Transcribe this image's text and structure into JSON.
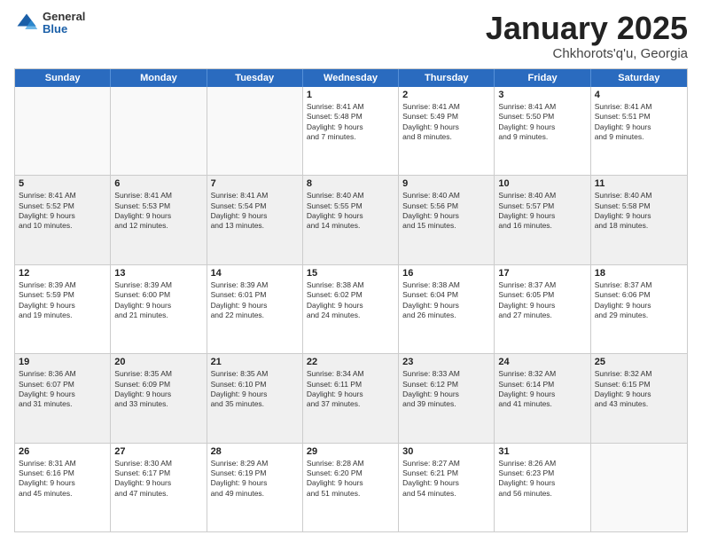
{
  "logo": {
    "general": "General",
    "blue": "Blue"
  },
  "header": {
    "title": "January 2025",
    "subtitle": "Chkhorots'q'u, Georgia"
  },
  "weekdays": [
    "Sunday",
    "Monday",
    "Tuesday",
    "Wednesday",
    "Thursday",
    "Friday",
    "Saturday"
  ],
  "weeks": [
    [
      {
        "day": "",
        "lines": []
      },
      {
        "day": "",
        "lines": []
      },
      {
        "day": "",
        "lines": []
      },
      {
        "day": "1",
        "lines": [
          "Sunrise: 8:41 AM",
          "Sunset: 5:48 PM",
          "Daylight: 9 hours",
          "and 7 minutes."
        ]
      },
      {
        "day": "2",
        "lines": [
          "Sunrise: 8:41 AM",
          "Sunset: 5:49 PM",
          "Daylight: 9 hours",
          "and 8 minutes."
        ]
      },
      {
        "day": "3",
        "lines": [
          "Sunrise: 8:41 AM",
          "Sunset: 5:50 PM",
          "Daylight: 9 hours",
          "and 9 minutes."
        ]
      },
      {
        "day": "4",
        "lines": [
          "Sunrise: 8:41 AM",
          "Sunset: 5:51 PM",
          "Daylight: 9 hours",
          "and 9 minutes."
        ]
      }
    ],
    [
      {
        "day": "5",
        "lines": [
          "Sunrise: 8:41 AM",
          "Sunset: 5:52 PM",
          "Daylight: 9 hours",
          "and 10 minutes."
        ]
      },
      {
        "day": "6",
        "lines": [
          "Sunrise: 8:41 AM",
          "Sunset: 5:53 PM",
          "Daylight: 9 hours",
          "and 12 minutes."
        ]
      },
      {
        "day": "7",
        "lines": [
          "Sunrise: 8:41 AM",
          "Sunset: 5:54 PM",
          "Daylight: 9 hours",
          "and 13 minutes."
        ]
      },
      {
        "day": "8",
        "lines": [
          "Sunrise: 8:40 AM",
          "Sunset: 5:55 PM",
          "Daylight: 9 hours",
          "and 14 minutes."
        ]
      },
      {
        "day": "9",
        "lines": [
          "Sunrise: 8:40 AM",
          "Sunset: 5:56 PM",
          "Daylight: 9 hours",
          "and 15 minutes."
        ]
      },
      {
        "day": "10",
        "lines": [
          "Sunrise: 8:40 AM",
          "Sunset: 5:57 PM",
          "Daylight: 9 hours",
          "and 16 minutes."
        ]
      },
      {
        "day": "11",
        "lines": [
          "Sunrise: 8:40 AM",
          "Sunset: 5:58 PM",
          "Daylight: 9 hours",
          "and 18 minutes."
        ]
      }
    ],
    [
      {
        "day": "12",
        "lines": [
          "Sunrise: 8:39 AM",
          "Sunset: 5:59 PM",
          "Daylight: 9 hours",
          "and 19 minutes."
        ]
      },
      {
        "day": "13",
        "lines": [
          "Sunrise: 8:39 AM",
          "Sunset: 6:00 PM",
          "Daylight: 9 hours",
          "and 21 minutes."
        ]
      },
      {
        "day": "14",
        "lines": [
          "Sunrise: 8:39 AM",
          "Sunset: 6:01 PM",
          "Daylight: 9 hours",
          "and 22 minutes."
        ]
      },
      {
        "day": "15",
        "lines": [
          "Sunrise: 8:38 AM",
          "Sunset: 6:02 PM",
          "Daylight: 9 hours",
          "and 24 minutes."
        ]
      },
      {
        "day": "16",
        "lines": [
          "Sunrise: 8:38 AM",
          "Sunset: 6:04 PM",
          "Daylight: 9 hours",
          "and 26 minutes."
        ]
      },
      {
        "day": "17",
        "lines": [
          "Sunrise: 8:37 AM",
          "Sunset: 6:05 PM",
          "Daylight: 9 hours",
          "and 27 minutes."
        ]
      },
      {
        "day": "18",
        "lines": [
          "Sunrise: 8:37 AM",
          "Sunset: 6:06 PM",
          "Daylight: 9 hours",
          "and 29 minutes."
        ]
      }
    ],
    [
      {
        "day": "19",
        "lines": [
          "Sunrise: 8:36 AM",
          "Sunset: 6:07 PM",
          "Daylight: 9 hours",
          "and 31 minutes."
        ]
      },
      {
        "day": "20",
        "lines": [
          "Sunrise: 8:35 AM",
          "Sunset: 6:09 PM",
          "Daylight: 9 hours",
          "and 33 minutes."
        ]
      },
      {
        "day": "21",
        "lines": [
          "Sunrise: 8:35 AM",
          "Sunset: 6:10 PM",
          "Daylight: 9 hours",
          "and 35 minutes."
        ]
      },
      {
        "day": "22",
        "lines": [
          "Sunrise: 8:34 AM",
          "Sunset: 6:11 PM",
          "Daylight: 9 hours",
          "and 37 minutes."
        ]
      },
      {
        "day": "23",
        "lines": [
          "Sunrise: 8:33 AM",
          "Sunset: 6:12 PM",
          "Daylight: 9 hours",
          "and 39 minutes."
        ]
      },
      {
        "day": "24",
        "lines": [
          "Sunrise: 8:32 AM",
          "Sunset: 6:14 PM",
          "Daylight: 9 hours",
          "and 41 minutes."
        ]
      },
      {
        "day": "25",
        "lines": [
          "Sunrise: 8:32 AM",
          "Sunset: 6:15 PM",
          "Daylight: 9 hours",
          "and 43 minutes."
        ]
      }
    ],
    [
      {
        "day": "26",
        "lines": [
          "Sunrise: 8:31 AM",
          "Sunset: 6:16 PM",
          "Daylight: 9 hours",
          "and 45 minutes."
        ]
      },
      {
        "day": "27",
        "lines": [
          "Sunrise: 8:30 AM",
          "Sunset: 6:17 PM",
          "Daylight: 9 hours",
          "and 47 minutes."
        ]
      },
      {
        "day": "28",
        "lines": [
          "Sunrise: 8:29 AM",
          "Sunset: 6:19 PM",
          "Daylight: 9 hours",
          "and 49 minutes."
        ]
      },
      {
        "day": "29",
        "lines": [
          "Sunrise: 8:28 AM",
          "Sunset: 6:20 PM",
          "Daylight: 9 hours",
          "and 51 minutes."
        ]
      },
      {
        "day": "30",
        "lines": [
          "Sunrise: 8:27 AM",
          "Sunset: 6:21 PM",
          "Daylight: 9 hours",
          "and 54 minutes."
        ]
      },
      {
        "day": "31",
        "lines": [
          "Sunrise: 8:26 AM",
          "Sunset: 6:23 PM",
          "Daylight: 9 hours",
          "and 56 minutes."
        ]
      },
      {
        "day": "",
        "lines": []
      }
    ]
  ]
}
